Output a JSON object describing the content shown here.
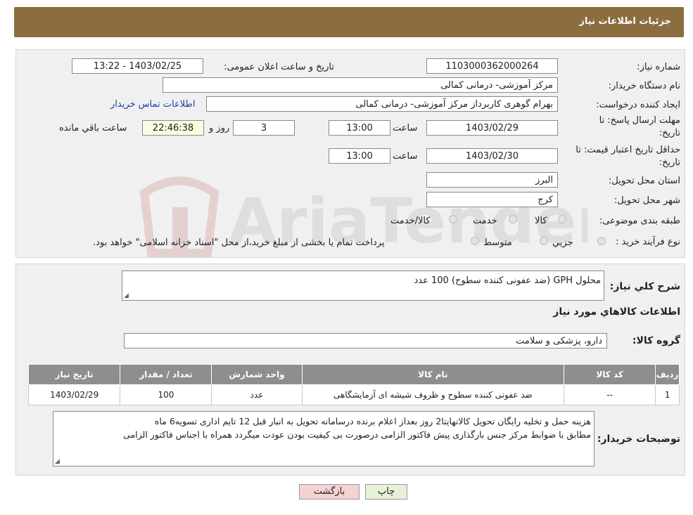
{
  "header": {
    "title": "جزئیات اطلاعات نیاز"
  },
  "form": {
    "need_number_label": "شماره نیاز:",
    "need_number": "1103000362000264",
    "announce_label": "تاریخ و ساعت اعلان عمومی:",
    "announce_value": "1403/02/25 - 13:22",
    "buyer_org_label": "نام دستگاه خریدار:",
    "buyer_org": "مرکز آموزشی- درمانی کمالی",
    "creator_label": "ایجاد کننده درخواست:",
    "creator": "بهرام گوهری کاربرداز مرکز آموزشی- درمانی کمالی",
    "contact_link": "اطلاعات تماس خریدار",
    "reply_deadline_label_1": "مهلت ارسال پاسخ: تا",
    "reply_deadline_label_2": "تاریخ:",
    "reply_date": "1403/02/29",
    "time_label": "ساعت",
    "reply_time": "13:00",
    "days_value": "3",
    "days_label": "روز و",
    "remaining_time": "22:46:38",
    "remaining_label": "ساعت باقي مانده",
    "price_validity_label_1": "حداقل تاریخ اعتبار قیمت: تا",
    "price_validity_label_2": "تاریخ:",
    "price_date": "1403/02/30",
    "price_time": "13:00",
    "province_label": "استان محل تحویل:",
    "province": "البرز",
    "city_label": "شهر محل تحویل:",
    "city": "کرج",
    "category_label": "طبقه بندی موضوعی:",
    "category_options": [
      "کالا",
      "خدمت",
      "کالا/خدمت"
    ],
    "process_label": "نوع فرآیند خرید :",
    "process_options": [
      "جزیي",
      "متوسط"
    ],
    "process_note": "پرداخت تمام یا بخشی از مبلغ خرید،از محل \"اسناد خزانه اسلامی\" خواهد بود."
  },
  "details": {
    "summary_label": "شرح کلي نیاز:",
    "summary": "محلول GPH (ضد عفونی کننده سطوح)  100 عدد",
    "items_heading": "اطلاعات کالاهاي مورد نیاز",
    "group_label": "گروه کالا:",
    "group_value": "دارو، پزشکی و سلامت",
    "table": {
      "headers": [
        "ردیف",
        "کد کالا",
        "نام کالا",
        "واحد شمارش",
        "تعداد / مقدار",
        "تاریخ نیاز"
      ],
      "rows": [
        [
          "1",
          "--",
          "ضد عفونی کننده سطوح و ظروف شیشه ای آزمایشگاهی",
          "عدد",
          "100",
          "1403/02/29"
        ]
      ]
    },
    "buyer_notes_label": "توضیحات خریدار:",
    "buyer_notes_line1": "هزینه حمل و تخلیه رایگان تحویل کالانهایتا2 روز بعداز اعلام برنده درسامانه تحویل به انبار قبل 12 تایم اداری تسویه6 ماه",
    "buyer_notes_line2": "مطابق با ضوابط مرکز جنس بارگذاری پیش فاکتور الزامی درصورت بی کیفیت بودن عودت میگردد همراه با اجناس فاکتور الزامی"
  },
  "buttons": {
    "print": "چاپ",
    "back": "بازگشت"
  },
  "watermark_text": "AriaTender.neT",
  "colors": {
    "header_bg": "#8c6d3f",
    "panel_bg": "#f0f0f0",
    "back_btn_bg": "#f5d3d3",
    "print_btn_bg": "#e6f2d6",
    "link": "#1b3fb0"
  }
}
